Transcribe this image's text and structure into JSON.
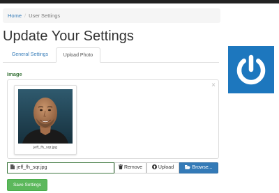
{
  "breadcrumb": {
    "home": "Home",
    "separator": "/",
    "current": "User Settings"
  },
  "page": {
    "title": "Update Your Settings"
  },
  "tabs": [
    {
      "label": "General Settings",
      "active": false
    },
    {
      "label": "Upload Photo",
      "active": true
    }
  ],
  "image_section": {
    "label": "Image",
    "close_glyph": "×",
    "thumbnail_caption": "jeff_fh_sqr.jpg"
  },
  "file_bar": {
    "filename": "jeff_fh_sqr.jpg",
    "file_icon": "file-icon",
    "remove_label": "Remove",
    "remove_icon": "trash-icon",
    "upload_label": "Upload",
    "upload_icon": "upload-circle-icon",
    "browse_label": "Browse...",
    "browse_icon": "folder-open-icon"
  },
  "actions": {
    "save_label": "Save Settings"
  },
  "colors": {
    "primary": "#337ab7",
    "success": "#5cb85c",
    "label_green": "#3c763d",
    "logo_blue": "#1d77be"
  }
}
